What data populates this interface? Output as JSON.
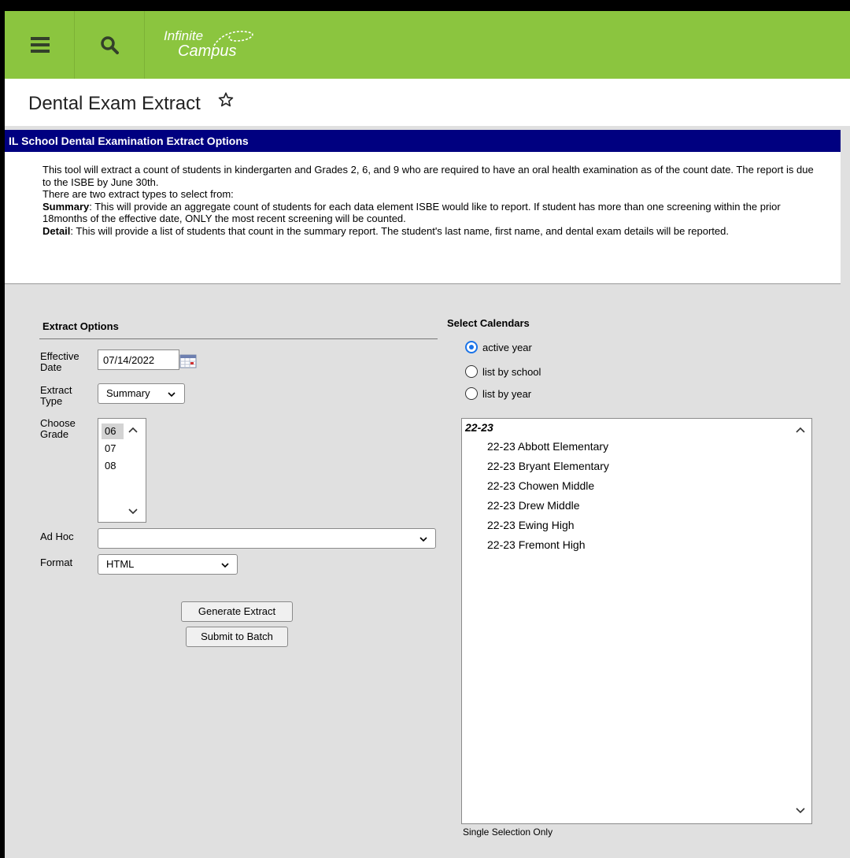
{
  "app": {
    "logo_line1": "Infinite",
    "logo_line2": "Campus",
    "brand_color": "#8bc53f",
    "header_band_color": "#000080"
  },
  "page": {
    "title": "Dental Exam Extract"
  },
  "options_panel": {
    "header": "IL School Dental Examination Extract Options",
    "description": {
      "line1": "This tool will extract a count of students in kindergarten and Grades 2, 6, and 9 who are required to have an oral health examination as of the count date. The report is due to the ISBE by June 30th.",
      "line2": "There are two extract types to select from:",
      "summary_label": "Summary",
      "summary_text": ": This will provide an aggregate count of students for each data element ISBE would like to report. If student has more than one screening within the prior 18months of the effective date, ONLY the most recent screening will be counted.",
      "detail_label": "Detail",
      "detail_text": ": This will provide a list of students that count in the summary report. The student's last name, first name, and dental exam details will be reported."
    }
  },
  "extract_options": {
    "title": "Extract Options",
    "effective_date_label_1": "Effective",
    "effective_date_label_2": "Date",
    "effective_date_value": "07/14/2022",
    "extract_type_label_1": "Extract",
    "extract_type_label_2": "Type",
    "extract_type_value": "Summary",
    "choose_grade_label_1": "Choose",
    "choose_grade_label_2": "Grade",
    "grades": [
      "06",
      "07",
      "08"
    ],
    "selected_grade": "06",
    "ad_hoc_label": "Ad Hoc",
    "ad_hoc_value": "",
    "format_label": "Format",
    "format_value": "HTML",
    "generate_button": "Generate Extract",
    "submit_button": "Submit to Batch"
  },
  "calendars": {
    "title": "Select Calendars",
    "radio_options": [
      "active year",
      "list by school",
      "list by year"
    ],
    "selected_radio": "active year",
    "group_label": "22-23",
    "items": [
      "22-23 Abbott Elementary",
      "22-23 Bryant Elementary",
      "22-23 Chowen Middle",
      "22-23 Drew Middle",
      "22-23 Ewing High",
      "22-23 Fremont High"
    ],
    "note": "Single Selection Only"
  }
}
